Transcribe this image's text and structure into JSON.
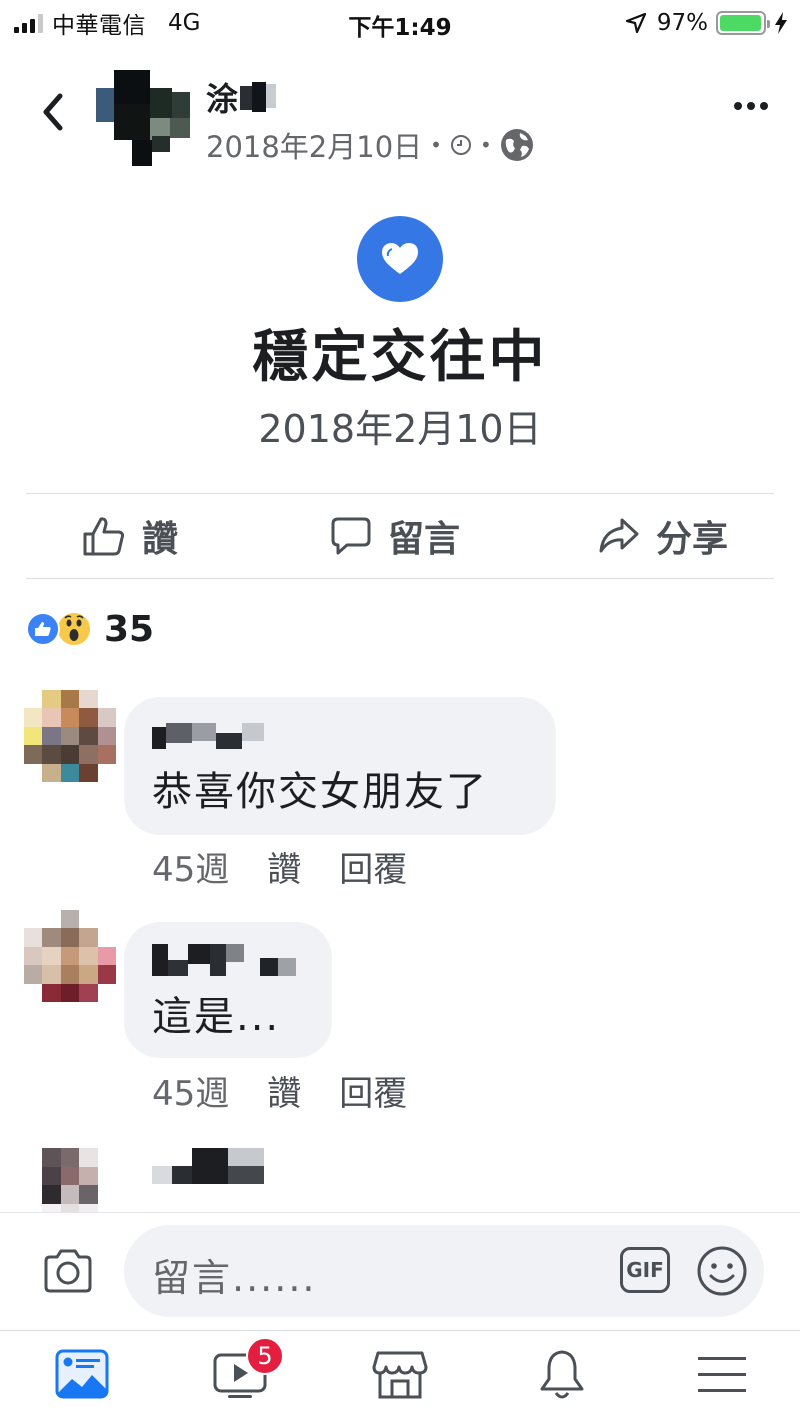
{
  "status_bar": {
    "carrier": "中華電信",
    "network": "4G",
    "time": "下午1:49",
    "battery_percent": "97%",
    "battery_level": 0.97
  },
  "post": {
    "poster_name": "涂",
    "date": "2018年2月10日",
    "visibility_icon": "globe-icon",
    "life_event": {
      "icon": "heart-icon",
      "title": "穩定交往中",
      "date": "2018年2月10日"
    }
  },
  "actions": {
    "like_label": "讚",
    "comment_label": "留言",
    "share_label": "分享"
  },
  "reactions": {
    "icons": [
      "like-icon",
      "wow-icon"
    ],
    "count": "35"
  },
  "comments": [
    {
      "text": "恭喜你交女朋友了",
      "time": "45週",
      "like_label": "讚",
      "reply_label": "回覆"
    },
    {
      "text": "這是...",
      "time": "45週",
      "like_label": "讚",
      "reply_label": "回覆"
    }
  ],
  "comment_input": {
    "placeholder": "留言......",
    "gif_label": "GIF"
  },
  "tab_bar": {
    "tabs": [
      "news-feed-icon",
      "watch-icon",
      "marketplace-icon",
      "notifications-icon",
      "menu-icon"
    ],
    "watch_badge": "5"
  },
  "colors": {
    "accent": "#3578e5",
    "badge": "#e41e3f",
    "bubble": "#f0f2f5"
  }
}
